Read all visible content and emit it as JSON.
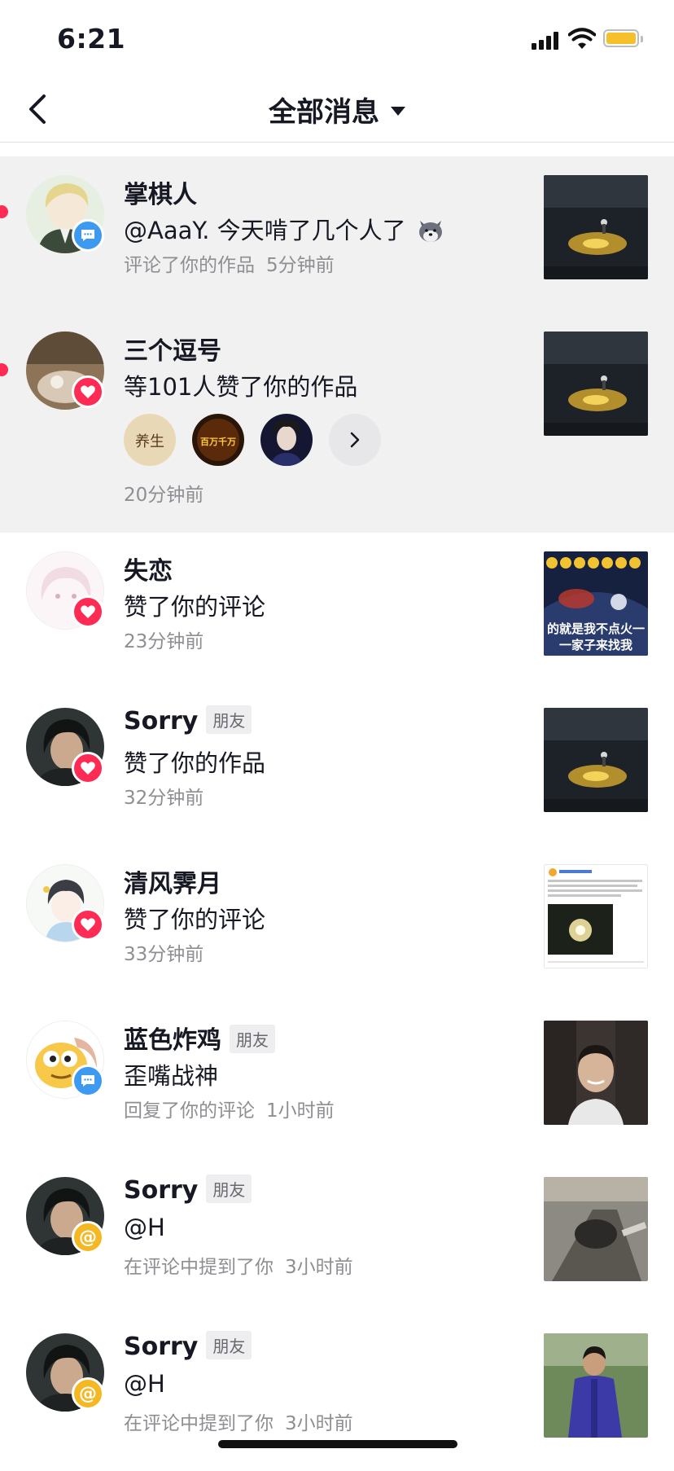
{
  "status_bar": {
    "time": "6:21"
  },
  "nav": {
    "title": "全部消息"
  },
  "notifications": [
    {
      "name": "掌棋人",
      "friend_tag": "",
      "content": "@AaaY. 今天啃了几个人了",
      "action": "评论了你的作品",
      "time": "5分钟前",
      "badge": "comment",
      "unread": true
    },
    {
      "name": "三个逗号",
      "friend_tag": "",
      "content": "等101人赞了你的作品",
      "action": "",
      "time": "20分钟前",
      "badge": "heart",
      "unread": true
    },
    {
      "name": "失恋",
      "friend_tag": "",
      "content": "赞了你的评论",
      "action": "",
      "time": "23分钟前",
      "badge": "heart",
      "unread": false
    },
    {
      "name": "Sorry",
      "friend_tag": "朋友",
      "content": "赞了你的作品",
      "action": "",
      "time": "32分钟前",
      "badge": "heart",
      "unread": false
    },
    {
      "name": "清风霁月",
      "friend_tag": "",
      "content": "赞了你的评论",
      "action": "",
      "time": "33分钟前",
      "badge": "heart",
      "unread": false
    },
    {
      "name": "蓝色炸鸡",
      "friend_tag": "朋友",
      "content": "歪嘴战神",
      "action": "回复了你的评论",
      "time": "1小时前",
      "badge": "comment",
      "unread": false
    },
    {
      "name": "Sorry",
      "friend_tag": "朋友",
      "content": "@H",
      "action": "在评论中提到了你",
      "time": "3小时前",
      "badge": "at",
      "unread": false
    },
    {
      "name": "Sorry",
      "friend_tag": "朋友",
      "content": "@H",
      "action": "在评论中提到了你",
      "time": "3小时前",
      "badge": "at",
      "unread": false
    }
  ],
  "likers_avatars": [
    {
      "text": "养生"
    },
    {
      "text": "百万千万"
    },
    {
      "text": ""
    }
  ],
  "thumb_caption": {
    "line1": "的就是我不点火一",
    "line2": "一家子来找我"
  },
  "colors": {
    "accent_red": "#fe2c55",
    "comment_blue": "#3e9af0",
    "mention_yellow": "#f5b722",
    "unread_bg": "#f1f1f2"
  }
}
